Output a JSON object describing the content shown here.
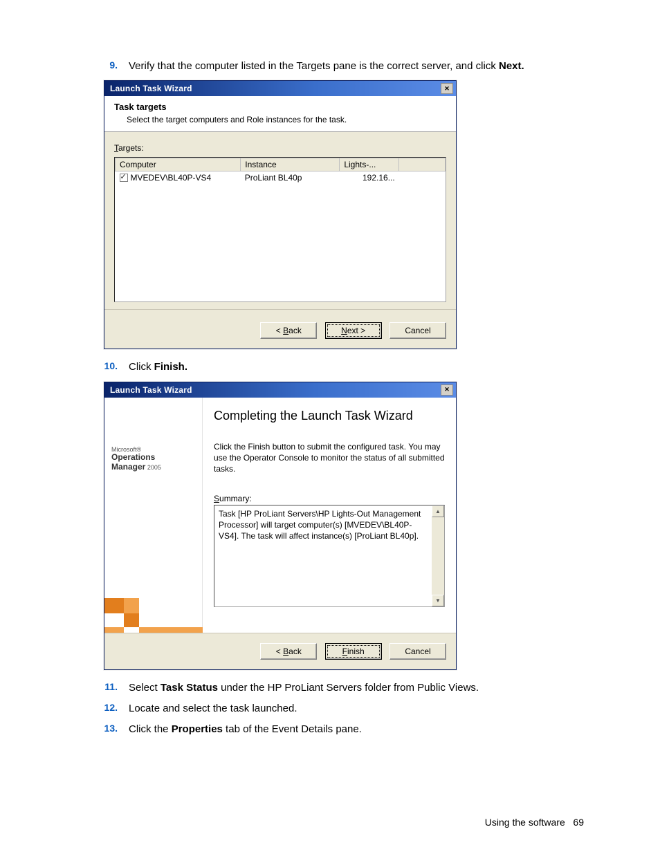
{
  "steps": {
    "9": {
      "num": "9.",
      "text_a": "Verify that the computer listed in the Targets pane is the correct server, and click ",
      "text_b": "Next."
    },
    "10": {
      "num": "10.",
      "text_a": "Click ",
      "text_b": "Finish."
    },
    "11": {
      "num": "11.",
      "text_a": "Select ",
      "text_b": "Task Status",
      "text_c": " under the HP ProLiant Servers folder from Public Views."
    },
    "12": {
      "num": "12.",
      "text_a": "Locate and select the task launched."
    },
    "13": {
      "num": "13.",
      "text_a": "Click the ",
      "text_b": "Properties",
      "text_c": " tab of the Event Details pane."
    }
  },
  "dialog1": {
    "title": "Launch Task Wizard",
    "header": "Task targets",
    "subheader": "Select the target computers and Role instances for the task.",
    "targets_label_u": "T",
    "targets_label_rest": "argets:",
    "columns": {
      "c1": "Computer",
      "c2": "Instance",
      "c3": "Lights-..."
    },
    "row": {
      "computer": "MVEDEV\\BL40P-VS4",
      "instance": "ProLiant BL40p",
      "lights": "192.16..."
    },
    "buttons": {
      "back_u": "B",
      "back_pre": "< ",
      "back_rest": "ack",
      "next_u": "N",
      "next_rest": "ext >",
      "cancel": "Cancel"
    }
  },
  "dialog2": {
    "title": "Launch Task Wizard",
    "brand": {
      "line1": "Microsoft®",
      "line2": "Operations",
      "line3": "Manager",
      "line3_small": " 2005"
    },
    "main_title": "Completing the Launch Task Wizard",
    "desc": "Click the Finish button to submit the configured task. You may use the Operator Console to monitor the status of all submitted tasks.",
    "summary_label_u": "S",
    "summary_label_rest": "ummary:",
    "summary_text": "Task [HP ProLiant Servers\\HP Lights-Out Management Processor] will target computer(s) [MVEDEV\\BL40P-VS4]. The task will affect instance(s) [ProLiant BL40p].",
    "buttons": {
      "back_u": "B",
      "back_pre": "< ",
      "back_rest": "ack",
      "finish_u": "F",
      "finish_rest": "inish",
      "cancel": "Cancel"
    }
  },
  "footer": {
    "label": "Using the software",
    "page": "69"
  }
}
